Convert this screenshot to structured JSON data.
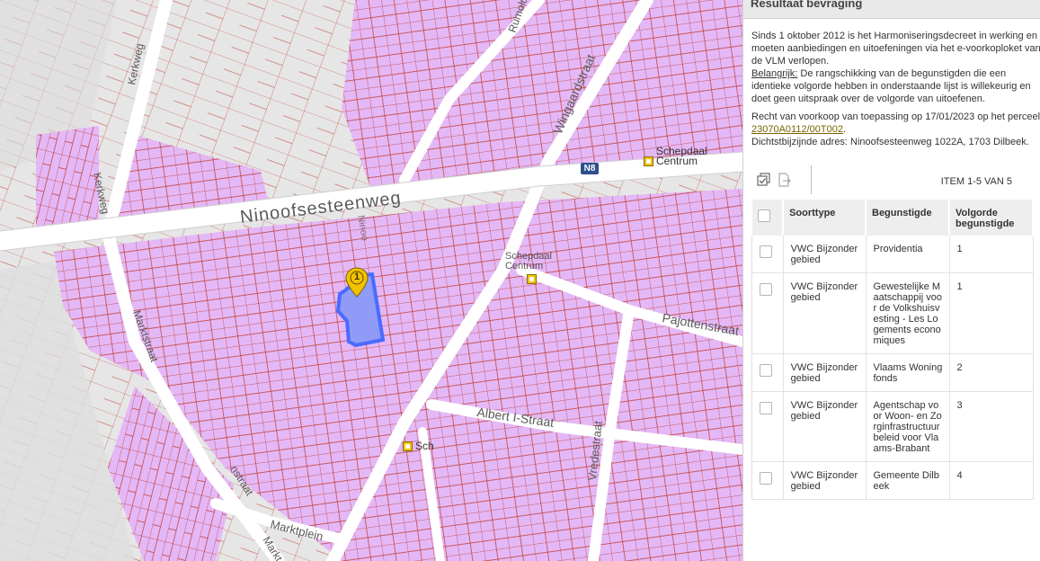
{
  "map": {
    "streets": {
      "ninoofsesteenweg": "Ninoofsesteenweg",
      "kerkweg_top": "Kerkweg",
      "kerkweg_mid": "Kerkweg",
      "marktstraat": "Marktstraat",
      "rumoldus": "Rumoldu",
      "wingaardstraat": "Wingaardstraat",
      "pajottenstraat": "Pajottenstraat",
      "albert": "Albert I-Straat",
      "vredestraat": "Vredestraat",
      "marktplein": "Marktplein",
      "ninoofs_sub": "Ninoo",
      "lower_left": "nstraat",
      "mark_bottom": "Markt"
    },
    "poi": {
      "schepdaal_centrum_top": [
        "Schepdaal",
        "Centrum"
      ],
      "schepdaal_centrum_mid": [
        "Schepdaal",
        "Centrum"
      ],
      "schepdaal_bottom": "Sch"
    },
    "route_badge": "N8",
    "marker_number": "1",
    "colors": {
      "parcel_fill": "#e4b8f6",
      "parcel_stroke": "#c0392b",
      "selection": "#4a6bff",
      "marker": "#f2c200"
    }
  },
  "panel": {
    "title": "Resultaat bevraging",
    "intro": "Sinds 1 oktober 2012 is het Harmoniseringsdecreet in werking en moeten aanbiedingen en uitoefeningen via het e-voorkoploket van de VLM verlopen.",
    "important_label": "Belangrijk:",
    "important_text": " De rangschikking van de begunstigden die een identieke volgorde hebben in onderstaande lijst is willekeurig en doet geen uitspraak over de volgorde van uitoefenen.",
    "right_text": "Recht van voorkoop van toepassing op 17/01/2023 op het perceel",
    "parcel_id": "23070A0112/00T002",
    "address_text": "Dichtstbijzijnde adres: Ninoofsesteenweg 1022A, 1703 Dilbeek.",
    "item_count": "ITEM 1-5 VAN 5",
    "table": {
      "headers": [
        "Soorttype",
        "Begunstigde",
        "Volgorde begunstigde"
      ],
      "rows": [
        {
          "soorttype": "VWC Bijzonder gebied",
          "begunstigde": "Providentia",
          "volgorde": "1"
        },
        {
          "soorttype": "VWC Bijzonder gebied",
          "begunstigde": "Gewestelijke Maatschappij voor de Volkshuisvesting - Les Logements economiques",
          "volgorde": "1"
        },
        {
          "soorttype": "VWC Bijzonder gebied",
          "begunstigde": "Vlaams Woningfonds",
          "volgorde": "2"
        },
        {
          "soorttype": "VWC Bijzonder gebied",
          "begunstigde": "Agentschap voor Woon- en Zorginfrastructuurbeleid voor Vlaams-Brabant",
          "volgorde": "3"
        },
        {
          "soorttype": "VWC Bijzonder gebied",
          "begunstigde": "Gemeente Dilbeek",
          "volgorde": "4"
        }
      ]
    }
  }
}
